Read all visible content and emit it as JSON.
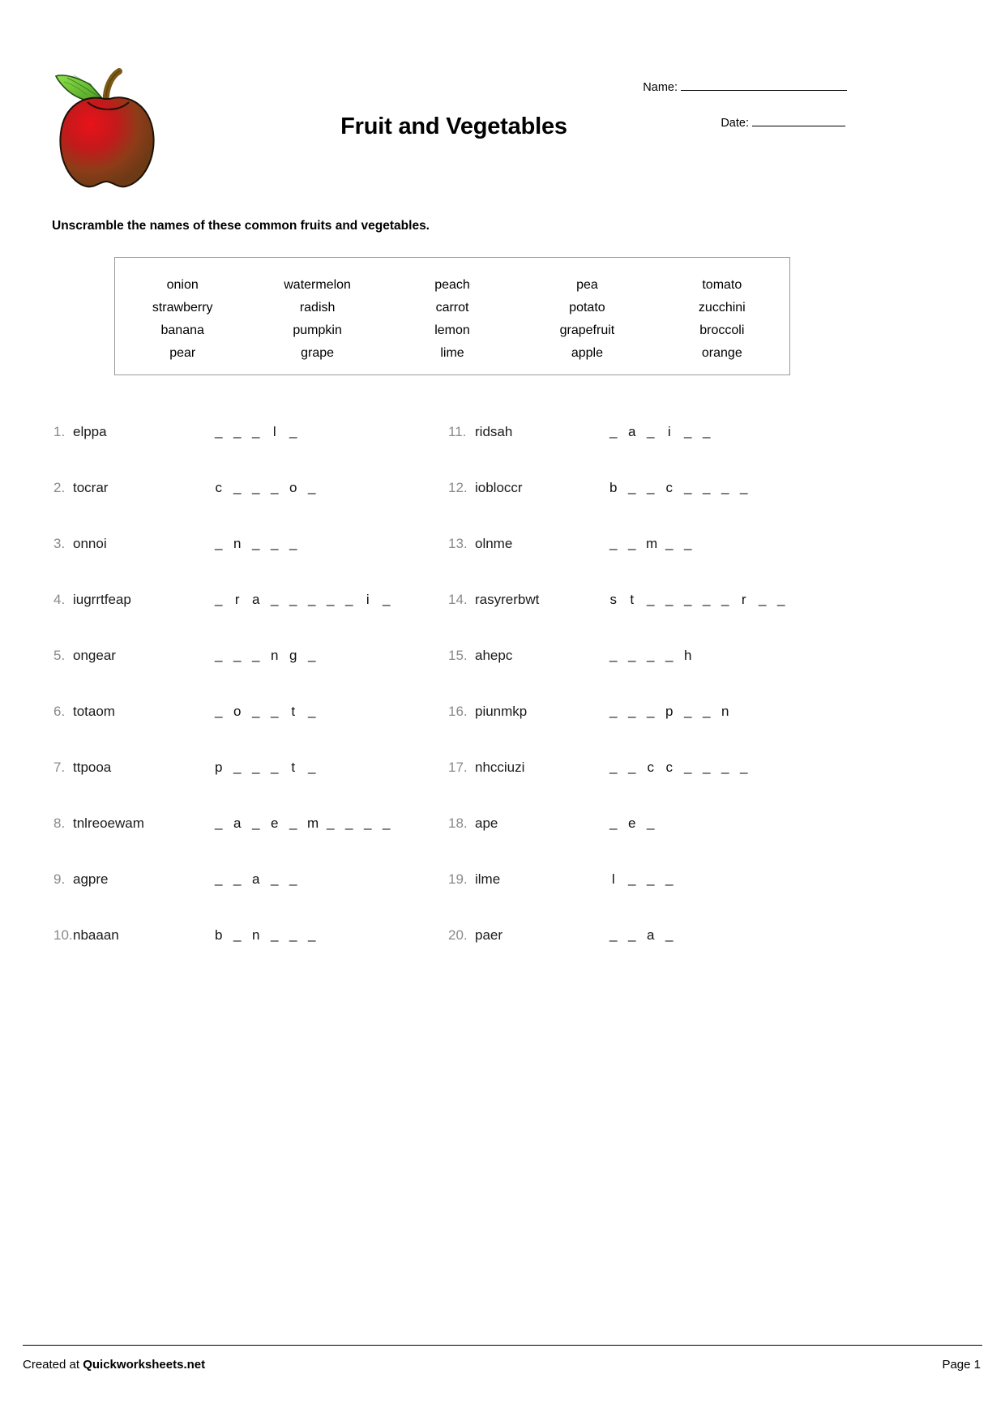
{
  "header": {
    "title": "Fruit and Vegetables",
    "name_label": "Name:",
    "date_label": "Date:",
    "logo_icon": "apple-icon"
  },
  "instruction": "Unscramble the names of these common fruits and vegetables.",
  "word_bank": {
    "rows": [
      [
        "onion",
        "watermelon",
        "peach",
        "pea",
        "tomato"
      ],
      [
        "strawberry",
        "radish",
        "carrot",
        "potato",
        "zucchini"
      ],
      [
        "banana",
        "pumpkin",
        "lemon",
        "grapefruit",
        "broccoli"
      ],
      [
        "pear",
        "grape",
        "lime",
        "apple",
        "orange"
      ]
    ]
  },
  "questions": {
    "left": [
      {
        "num": "1.",
        "scramble": "elppa",
        "slots": [
          "_",
          "_",
          "_",
          "l",
          "_"
        ]
      },
      {
        "num": "2.",
        "scramble": "tocrar",
        "slots": [
          "c",
          "_",
          "_",
          "_",
          "o",
          "_"
        ]
      },
      {
        "num": "3.",
        "scramble": "onnoi",
        "slots": [
          "_",
          "n",
          "_",
          "_",
          "_"
        ]
      },
      {
        "num": "4.",
        "scramble": "iugrrtfeap",
        "slots": [
          "_",
          "r",
          "a",
          "_",
          "_",
          "_",
          "_",
          "_",
          "i",
          "_"
        ]
      },
      {
        "num": "5.",
        "scramble": "ongear",
        "slots": [
          "_",
          "_",
          "_",
          "n",
          "g",
          "_"
        ]
      },
      {
        "num": "6.",
        "scramble": "totaom",
        "slots": [
          "_",
          "o",
          "_",
          "_",
          "t",
          "_"
        ]
      },
      {
        "num": "7.",
        "scramble": "ttpooa",
        "slots": [
          "p",
          "_",
          "_",
          "_",
          "t",
          "_"
        ]
      },
      {
        "num": "8.",
        "scramble": "tnlreoewam",
        "slots": [
          "_",
          "a",
          "_",
          "e",
          "_",
          "m",
          "_",
          "_",
          "_",
          "_"
        ]
      },
      {
        "num": "9.",
        "scramble": "agpre",
        "slots": [
          "_",
          "_",
          "a",
          "_",
          "_"
        ]
      },
      {
        "num": "10.",
        "scramble": "nbaaan",
        "slots": [
          "b",
          "_",
          "n",
          "_",
          "_",
          "_"
        ]
      }
    ],
    "right": [
      {
        "num": "11.",
        "scramble": "ridsah",
        "slots": [
          "_",
          "a",
          "_",
          "i",
          "_",
          "_"
        ]
      },
      {
        "num": "12.",
        "scramble": "iobloccr",
        "slots": [
          "b",
          "_",
          "_",
          "c",
          "_",
          "_",
          "_",
          "_"
        ]
      },
      {
        "num": "13.",
        "scramble": "olnme",
        "slots": [
          "_",
          "_",
          "m",
          "_",
          "_"
        ]
      },
      {
        "num": "14.",
        "scramble": "rasyrerbwt",
        "slots": [
          "s",
          "t",
          "_",
          "_",
          "_",
          "_",
          "_",
          "r",
          "_",
          "_"
        ]
      },
      {
        "num": "15.",
        "scramble": "ahepc",
        "slots": [
          "_",
          "_",
          "_",
          "_",
          "h"
        ]
      },
      {
        "num": "16.",
        "scramble": "piunmkp",
        "slots": [
          "_",
          "_",
          "_",
          "p",
          "_",
          "_",
          "n"
        ]
      },
      {
        "num": "17.",
        "scramble": "nhcciuzi",
        "slots": [
          "_",
          "_",
          "c",
          "c",
          "_",
          "_",
          "_",
          "_"
        ]
      },
      {
        "num": "18.",
        "scramble": "ape",
        "slots": [
          "_",
          "e",
          "_"
        ]
      },
      {
        "num": "19.",
        "scramble": "ilme",
        "slots": [
          "l",
          "_",
          "_",
          "_"
        ]
      },
      {
        "num": "20.",
        "scramble": "paer",
        "slots": [
          "_",
          "_",
          "a",
          "_"
        ]
      }
    ]
  },
  "footer": {
    "created_prefix": "Created at ",
    "brand": "Quickworksheets.net",
    "page": "Page 1"
  }
}
